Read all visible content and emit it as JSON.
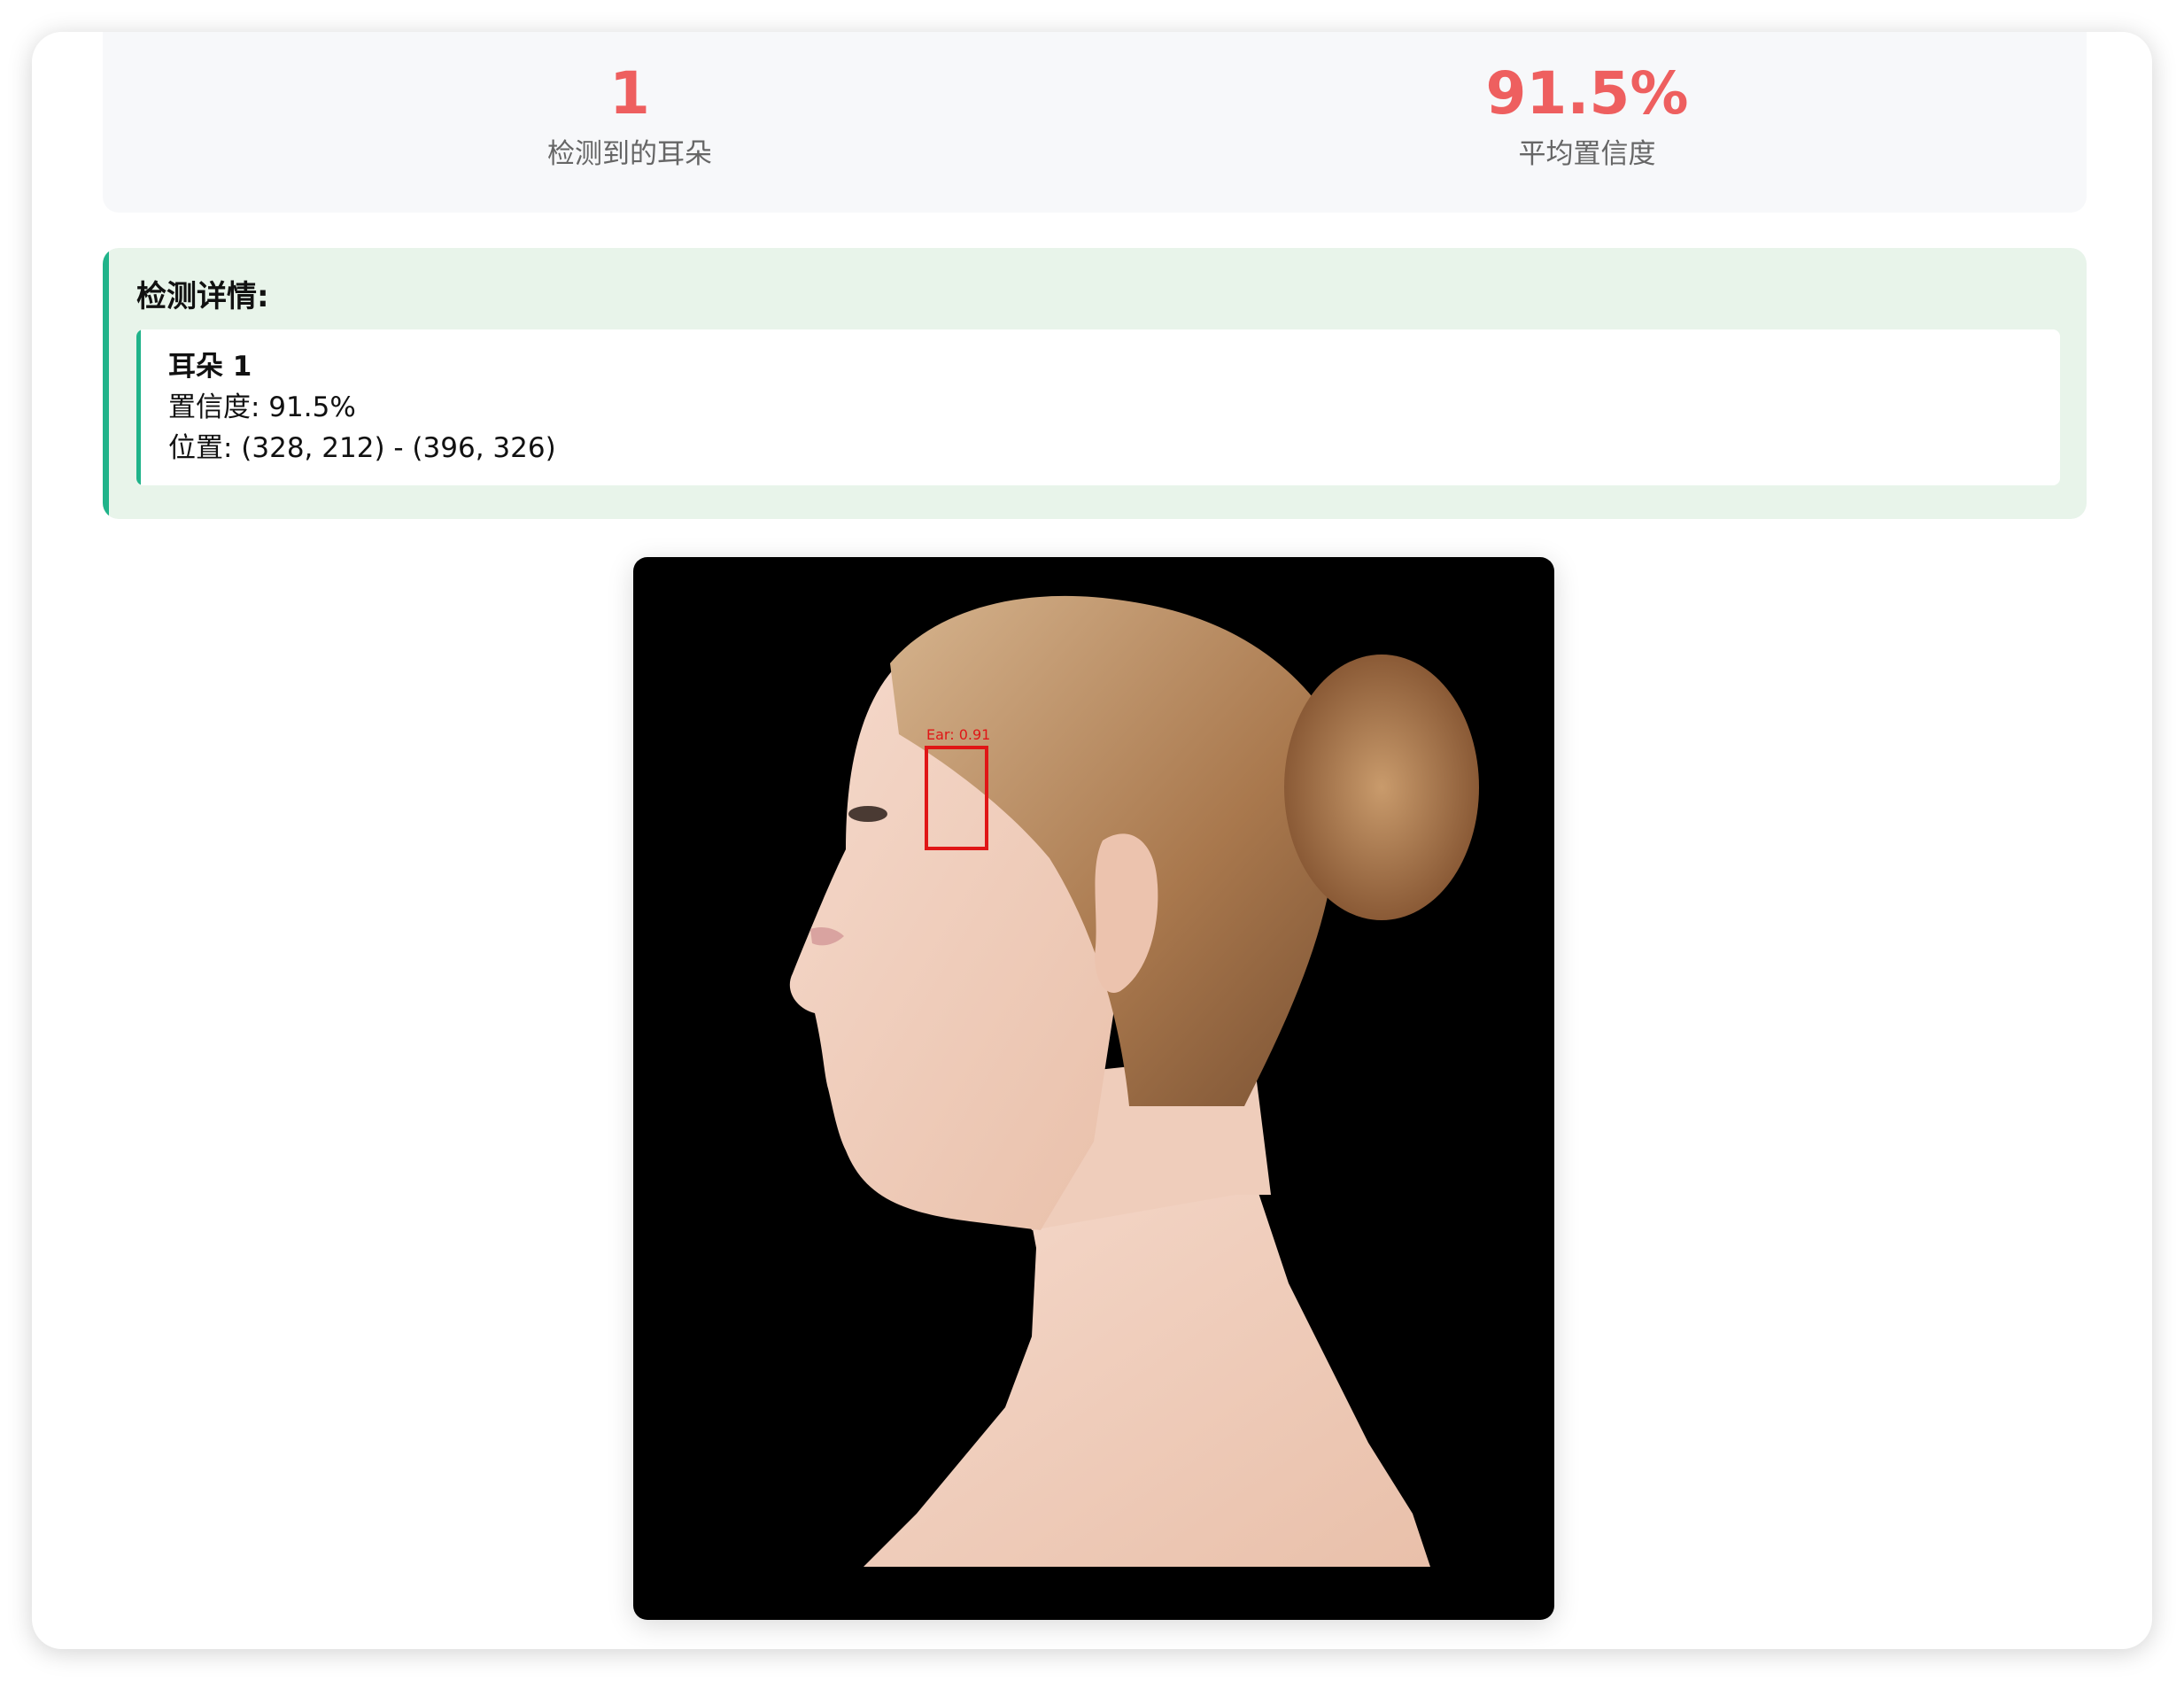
{
  "stats": {
    "ear_count": "1",
    "ear_count_label": "检测到的耳朵",
    "avg_confidence": "91.5%",
    "avg_confidence_label": "平均置信度"
  },
  "details": {
    "title": "检测详情:",
    "items": [
      {
        "title": "耳朵 1",
        "confidence": "置信度: 91.5%",
        "position": "位置: (328, 212) - (396, 326)"
      }
    ]
  },
  "result_image": {
    "detection_label": "Ear: 0.91",
    "box_color": "#e01616",
    "background": "#000000"
  },
  "colors": {
    "accent": "#20b38a",
    "stat_value": "#ee5f5f",
    "details_bg": "#e8f4ea"
  }
}
